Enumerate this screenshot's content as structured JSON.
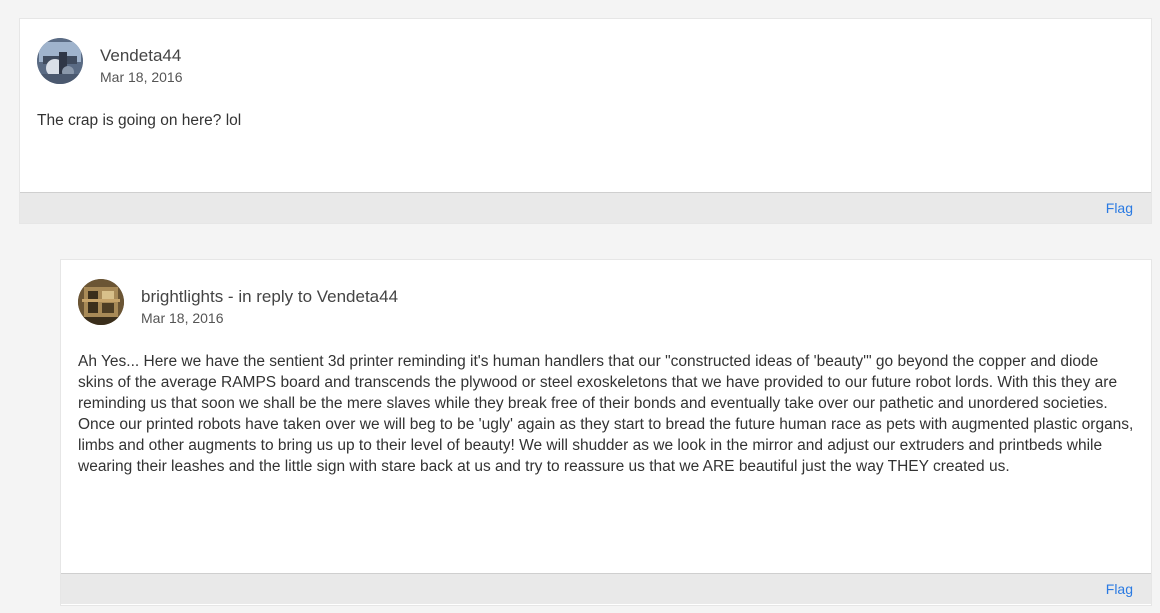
{
  "comments": [
    {
      "author": "Vendeta44",
      "date": "Mar 18, 2016",
      "text": "The crap is going on here? lol",
      "flag_label": "Flag",
      "avatar_icon": "user-avatar-icon"
    },
    {
      "author": "brightlights - in reply to Vendeta44",
      "date": "Mar 18, 2016",
      "text": "Ah Yes... Here we have the sentient 3d printer reminding it's human handlers that our \"constructed ideas of 'beauty'\" go beyond the copper and diode skins of the average RAMPS board and transcends the plywood or steel exoskeletons that we have provided to our future robot lords. With this they are reminding us that soon we shall be the mere slaves while they break free of their bonds and eventually take over our pathetic and unordered societies. Once our printed robots have taken over we will beg to be 'ugly' again as they start to bread the future human race as pets with augmented plastic organs, limbs and other augments to bring us up to their level of beauty! We will shudder as we look in the mirror and adjust our extruders and printbeds while wearing their leashes and the little sign with stare back at us and try to reassure us that we ARE beautiful just the way THEY created us.",
      "flag_label": "Flag",
      "avatar_icon": "user-avatar-icon"
    }
  ],
  "colors": {
    "link": "#2a7ae2",
    "footer_bg": "#e9e9e9",
    "page_bg": "#f4f4f4"
  }
}
